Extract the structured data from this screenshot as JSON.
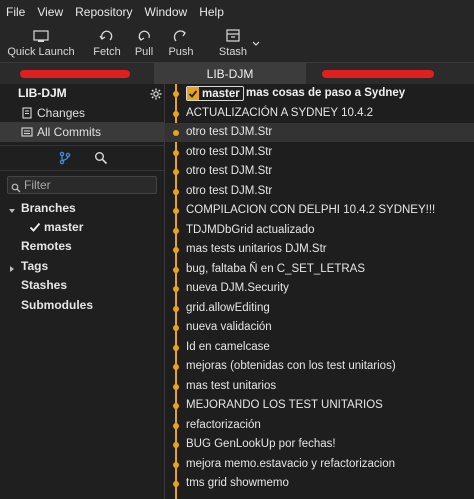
{
  "menu": [
    "File",
    "View",
    "Repository",
    "Window",
    "Help"
  ],
  "toolbar": {
    "quick_launch": "Quick Launch",
    "fetch": "Fetch",
    "pull": "Pull",
    "push": "Push",
    "stash": "Stash"
  },
  "tabs": {
    "active": "LIB-DJM"
  },
  "sidebar": {
    "repo_name": "LIB-DJM",
    "changes": "Changes",
    "all_commits": "All Commits",
    "filter_placeholder": "Filter",
    "branches": "Branches",
    "branch_master": "master",
    "remotes": "Remotes",
    "tags": "Tags",
    "stashes": "Stashes",
    "submodules": "Submodules"
  },
  "log": {
    "head_branch": "master",
    "head_message": "mas cosas de paso a Sydney",
    "commits": [
      "ACTUALIZACIÓN A SYDNEY 10.4.2",
      "otro test DJM.Str",
      "otro test DJM.Str",
      "otro test DJM.Str",
      "otro test DJM.Str",
      "COMPILACION CON DELPHI 10.4.2 SYDNEY!!!",
      "TDJMDbGrid actualizado",
      "mas tests unitarios DJM.Str",
      "bug, faltaba Ñ en C_SET_LETRAS",
      "nueva DJM.Security",
      "grid.allowEditing",
      "nueva validación",
      "Id en camelcase",
      "mejoras (obtenidas con los test unitarios)",
      "mas test unitarios",
      "MEJORANDO LOS TEST UNITARIOS",
      "refactorización",
      "BUG GenLookUp por fechas!",
      "mejora memo.estavacio y refactorizacion",
      "tms grid showmemo"
    ]
  },
  "colors": {
    "graph": "#e8a317",
    "redaction": "#e01f1f",
    "branch_icon": "#3d8fe0"
  }
}
